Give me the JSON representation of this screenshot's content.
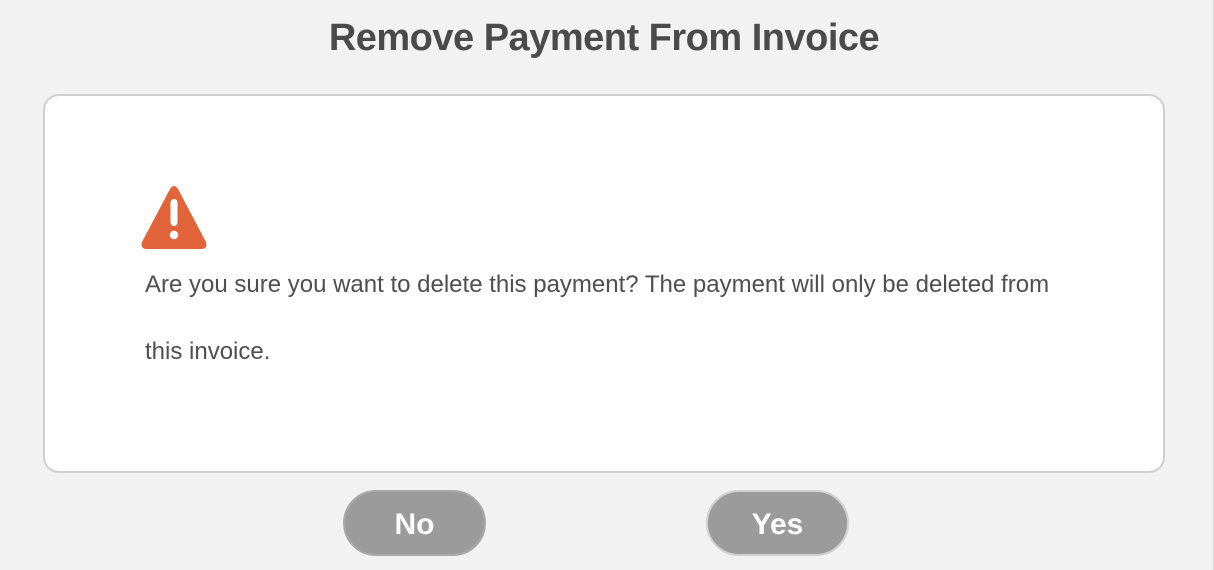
{
  "dialog": {
    "title": "Remove Payment From Invoice",
    "icon": "warning-triangle-icon",
    "message": "Are you sure you want to delete this payment? The payment will only be deleted from this invoice.",
    "buttons": {
      "no_label": "No",
      "yes_label": "Yes"
    }
  },
  "colors": {
    "background": "#f2f2f2",
    "card": "#ffffff",
    "warning": "#e2643a",
    "button": "#9b9b9b",
    "title_text": "#4a4a4a"
  }
}
